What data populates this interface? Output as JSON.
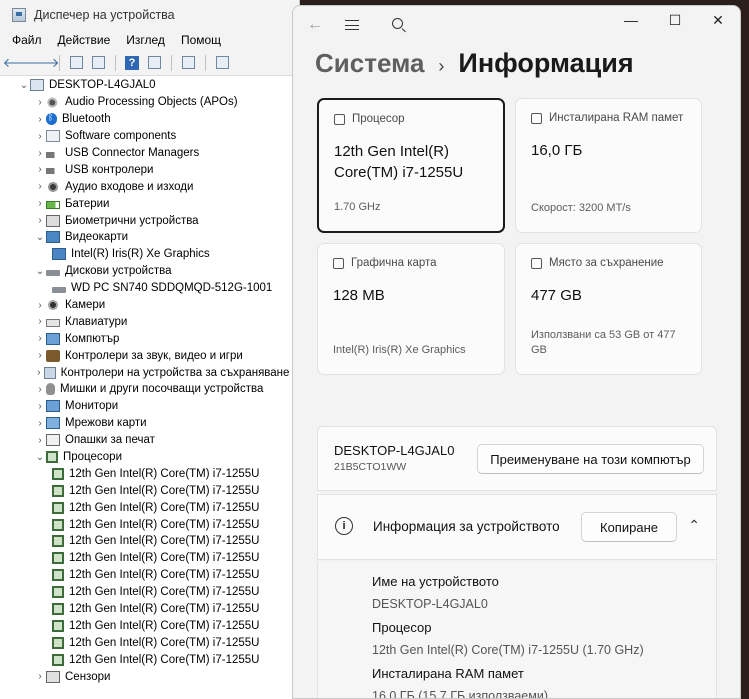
{
  "devmgr": {
    "title": "Диспечер на устройства",
    "menu": [
      "Файл",
      "Действие",
      "Изглед",
      "Помощ"
    ],
    "tree": [
      {
        "level": 0,
        "expand": "⌄",
        "icon": "pc",
        "label": "DESKTOP-L4GJAL0"
      },
      {
        "level": 1,
        "expand": "›",
        "icon": "speaker",
        "label": "Audio Processing Objects (APOs)"
      },
      {
        "level": 1,
        "expand": "›",
        "icon": "bt",
        "label": "Bluetooth"
      },
      {
        "level": 1,
        "expand": "›",
        "icon": "comp",
        "label": "Software components"
      },
      {
        "level": 1,
        "expand": "›",
        "icon": "usb",
        "label": "USB Connector Managers"
      },
      {
        "level": 1,
        "expand": "›",
        "icon": "usb",
        "label": "USB контролери"
      },
      {
        "level": 1,
        "expand": "›",
        "icon": "audio",
        "label": "Аудио входове и изходи"
      },
      {
        "level": 1,
        "expand": "›",
        "icon": "battery",
        "label": "Батерии"
      },
      {
        "level": 1,
        "expand": "›",
        "icon": "bio",
        "label": "Биометрични устройства"
      },
      {
        "level": 1,
        "expand": "⌄",
        "icon": "display",
        "label": "Видеокарти"
      },
      {
        "level": 2,
        "expand": "",
        "icon": "display",
        "label": "Intel(R) Iris(R) Xe Graphics"
      },
      {
        "level": 1,
        "expand": "⌄",
        "icon": "disk",
        "label": "Дискови устройства"
      },
      {
        "level": 2,
        "expand": "",
        "icon": "disk",
        "label": "WD PC SN740 SDDQMQD-512G-1001"
      },
      {
        "level": 1,
        "expand": "›",
        "icon": "camera",
        "label": "Камери"
      },
      {
        "level": 1,
        "expand": "›",
        "icon": "kbd",
        "label": "Клавиатури"
      },
      {
        "level": 1,
        "expand": "›",
        "icon": "monitor",
        "label": "Компютър"
      },
      {
        "level": 1,
        "expand": "›",
        "icon": "sound",
        "label": "Контролери за звук, видео и игри"
      },
      {
        "level": 1,
        "expand": "›",
        "icon": "storage",
        "label": "Контролери на устройства за съхраняване н"
      },
      {
        "level": 1,
        "expand": "›",
        "icon": "mouse",
        "label": "Мишки и други посочващи устройства"
      },
      {
        "level": 1,
        "expand": "›",
        "icon": "monitor",
        "label": "Монитори"
      },
      {
        "level": 1,
        "expand": "›",
        "icon": "net",
        "label": "Мрежови карти"
      },
      {
        "level": 1,
        "expand": "›",
        "icon": "queue",
        "label": "Опашки за печат"
      },
      {
        "level": 1,
        "expand": "⌄",
        "icon": "cpu",
        "label": "Процесори"
      },
      {
        "level": 2,
        "expand": "",
        "icon": "cpu",
        "label": "12th Gen Intel(R) Core(TM) i7-1255U"
      },
      {
        "level": 2,
        "expand": "",
        "icon": "cpu",
        "label": "12th Gen Intel(R) Core(TM) i7-1255U"
      },
      {
        "level": 2,
        "expand": "",
        "icon": "cpu",
        "label": "12th Gen Intel(R) Core(TM) i7-1255U"
      },
      {
        "level": 2,
        "expand": "",
        "icon": "cpu",
        "label": "12th Gen Intel(R) Core(TM) i7-1255U"
      },
      {
        "level": 2,
        "expand": "",
        "icon": "cpu",
        "label": "12th Gen Intel(R) Core(TM) i7-1255U"
      },
      {
        "level": 2,
        "expand": "",
        "icon": "cpu",
        "label": "12th Gen Intel(R) Core(TM) i7-1255U"
      },
      {
        "level": 2,
        "expand": "",
        "icon": "cpu",
        "label": "12th Gen Intel(R) Core(TM) i7-1255U"
      },
      {
        "level": 2,
        "expand": "",
        "icon": "cpu",
        "label": "12th Gen Intel(R) Core(TM) i7-1255U"
      },
      {
        "level": 2,
        "expand": "",
        "icon": "cpu",
        "label": "12th Gen Intel(R) Core(TM) i7-1255U"
      },
      {
        "level": 2,
        "expand": "",
        "icon": "cpu",
        "label": "12th Gen Intel(R) Core(TM) i7-1255U"
      },
      {
        "level": 2,
        "expand": "",
        "icon": "cpu",
        "label": "12th Gen Intel(R) Core(TM) i7-1255U"
      },
      {
        "level": 2,
        "expand": "",
        "icon": "cpu",
        "label": "12th Gen Intel(R) Core(TM) i7-1255U"
      },
      {
        "level": 1,
        "expand": "›",
        "icon": "sensor",
        "label": "Сензори"
      }
    ]
  },
  "settings": {
    "breadcrumb_parent": "Система",
    "breadcrumb_sep": "›",
    "page_title": "Информация",
    "cards": {
      "cpu": {
        "header": "Процесор",
        "value": "12th Gen Intel(R) Core(TM) i7-1255U",
        "sub": "1.70 GHz"
      },
      "ram": {
        "header": "Инсталирана RAM памет",
        "value": "16,0 ГБ",
        "sub": "Скорост: 3200 MT/s"
      },
      "gpu": {
        "header": "Графична карта",
        "value": "128 MB",
        "sub": "Intel(R) Iris(R) Xe Graphics"
      },
      "storage": {
        "header": "Място за съхранение",
        "value": "477 GB",
        "sub": "Използвани са 53 GB от 477 GB"
      }
    },
    "pc_name": "DESKTOP-L4GJAL0",
    "pc_model": "21B5CTO1WW",
    "rename_button": "Преименуване на този компютър",
    "device_info_title": "Информация за устройството",
    "copy_button": "Копиране",
    "details": [
      {
        "key": "Име на устройството",
        "value": "DESKTOP-L4GJAL0"
      },
      {
        "key": "Процесор",
        "value": "12th Gen Intel(R) Core(TM) i7-1255U (1.70 GHz)"
      },
      {
        "key": "Инсталирана RAM памет",
        "value": "16,0 ГБ (15,7 ГБ използваеми)"
      }
    ]
  }
}
